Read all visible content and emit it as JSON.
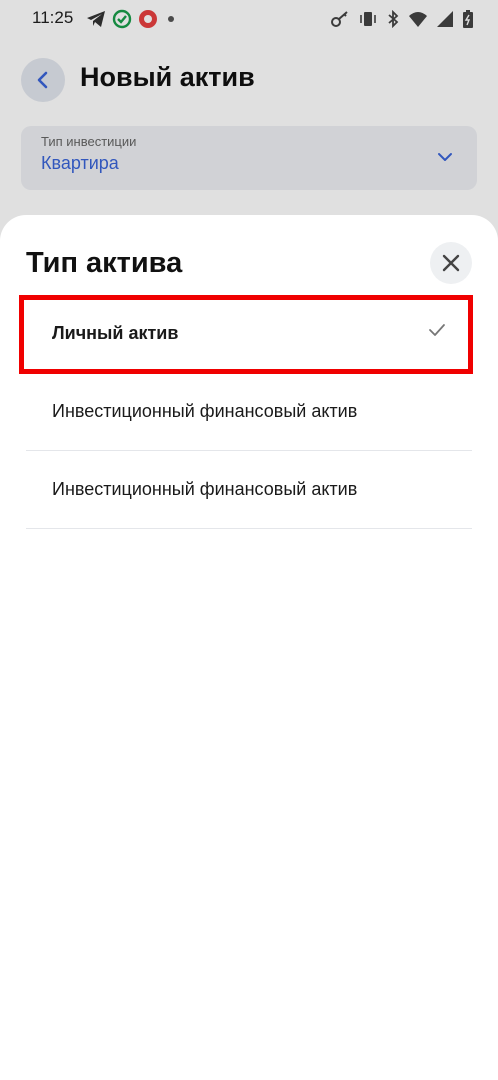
{
  "status_bar": {
    "time": "11:25",
    "left_icons": [
      "telegram-icon",
      "check-circle-icon",
      "app-icon",
      "dot-icon"
    ],
    "right_icons": [
      "key-icon",
      "vibrate-icon",
      "bluetooth-icon",
      "wifi-icon",
      "signal-icon",
      "battery-icon"
    ]
  },
  "header": {
    "title": "Новый актив"
  },
  "invest_field": {
    "label": "Тип инвестиции",
    "value": "Квартира"
  },
  "sheet": {
    "title": "Тип актива",
    "options": [
      {
        "label": "Личный актив",
        "selected": true
      },
      {
        "label": "Инвестиционный финансовый актив",
        "selected": false
      },
      {
        "label": "Инвестиционный финансовый актив",
        "selected": false
      }
    ]
  },
  "colors": {
    "accent": "#3a64d8",
    "highlight": "#f00000"
  }
}
